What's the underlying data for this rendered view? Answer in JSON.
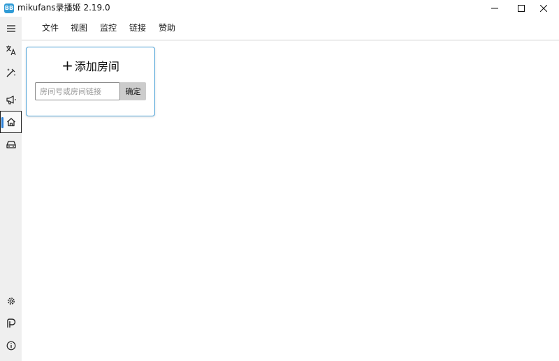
{
  "window": {
    "icon_text": "BB",
    "title": "mikufans录播姬 2.19.0"
  },
  "navrail": {
    "items_top": [
      {
        "icon": "menu-icon"
      },
      {
        "icon": "translate-icon"
      },
      {
        "icon": "magic-wand-icon"
      },
      {
        "icon": "announcement-icon"
      },
      {
        "icon": "home-icon",
        "active": true
      },
      {
        "icon": "car-icon"
      }
    ],
    "items_bottom": [
      {
        "icon": "gear-icon"
      },
      {
        "icon": "patreon-icon"
      },
      {
        "icon": "info-icon"
      }
    ]
  },
  "menubar": {
    "file": "文件",
    "view": "视图",
    "monitor": "监控",
    "links": "链接",
    "sponsor": "赞助"
  },
  "add_room_card": {
    "title": "添加房间",
    "input_placeholder": "房间号或房间链接",
    "input_value": "",
    "confirm_label": "确定"
  },
  "colors": {
    "accent": "#2b7fd6",
    "card_border": "#4fa3d8",
    "nav_bg": "#efefef",
    "button_bg": "#cccccc"
  }
}
